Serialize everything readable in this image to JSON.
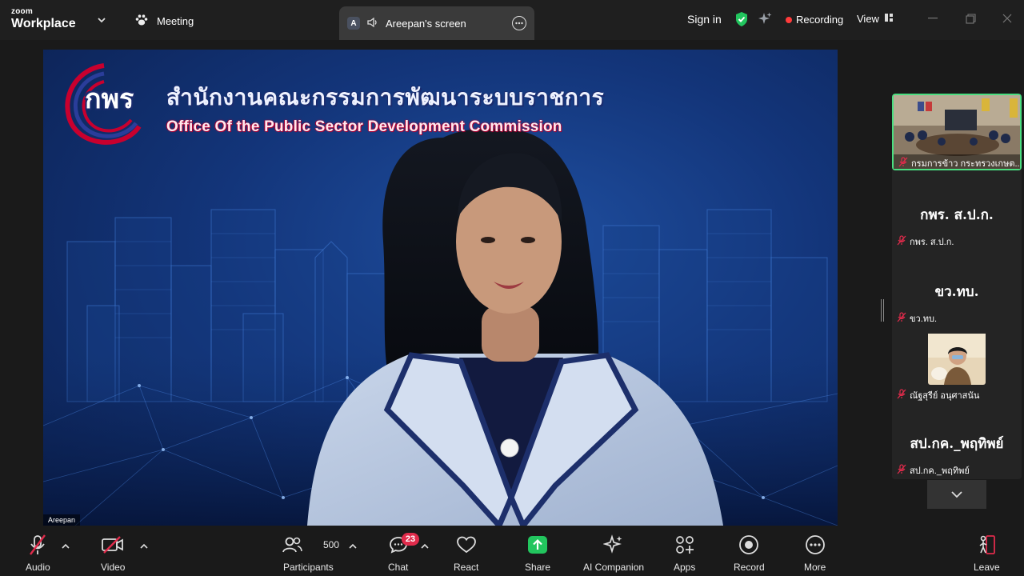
{
  "app": {
    "logo_top": "zoom",
    "logo_bottom": "Workplace"
  },
  "header": {
    "meeting_label": "Meeting",
    "screen_tab": {
      "avatar_letter": "A",
      "label": "Areepan's screen"
    },
    "sign_in": "Sign in",
    "recording": "Recording",
    "view": "View"
  },
  "main_video": {
    "org_abbr": "กพร",
    "org_name_th": "สำนักงานคณะกรรมการพัฒนาระบบราชการ",
    "org_name_en": "Office Of the Public Sector Development Commission",
    "speaker_name": "Areepan"
  },
  "gallery": [
    {
      "type": "video",
      "name": "กรมการข้าว กระทรวงเกษต..",
      "muted": true
    },
    {
      "type": "name",
      "display": "กพร. ส.ป.ก.",
      "name": "กพร. ส.ป.ก.",
      "muted": true
    },
    {
      "type": "name",
      "display": "ขว.ทบ.",
      "name": "ขว.ทบ.",
      "muted": true
    },
    {
      "type": "avatar",
      "name": "ณัฐสุรีย์ อนุศาสนัน",
      "muted": true
    },
    {
      "type": "name",
      "display": "สป.กค._พฤทิพย์",
      "name": "สป.กค._พฤทิพย์",
      "muted": true
    }
  ],
  "toolbar": {
    "audio": "Audio",
    "video": "Video",
    "participants": "Participants",
    "participant_count": "500",
    "chat": "Chat",
    "chat_badge": "23",
    "react": "React",
    "share": "Share",
    "ai_companion": "AI Companion",
    "apps": "Apps",
    "record": "Record",
    "more": "More",
    "leave": "Leave"
  },
  "colors": {
    "accent_green": "#22c55e",
    "recording_red": "#ff3b3b",
    "badge_red": "#e02b4b",
    "active_tile_border": "#4ade80"
  }
}
